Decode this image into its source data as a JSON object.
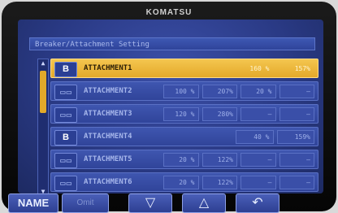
{
  "brand": "KOMATSU",
  "title": "Breaker/Attachment Setting",
  "rows": [
    {
      "badge": "B",
      "badge_style": "bright",
      "name": "ATTACHMENT1",
      "c1_pre": "",
      "c1": "",
      "c2_pre": "",
      "c2": "160 %",
      "c3_pre": "",
      "c3": "157%"
    },
    {
      "badge": "",
      "badge_style": "dim",
      "name": "ATTACHMENT2",
      "c1_pre": "",
      "c1": "100 %",
      "c2_pre": "",
      "c2": "207%",
      "c3_pre": "",
      "c3": "20 %",
      "c4": "—"
    },
    {
      "badge": "",
      "badge_style": "dim",
      "name": "ATTACHMENT3",
      "c1_pre": "",
      "c1": "120 %",
      "c2_pre": "",
      "c2": "280%",
      "c3_pre": "",
      "c3": "—",
      "c4": "—"
    },
    {
      "badge": "B",
      "badge_style": "bright",
      "name": "ATTACHMENT4",
      "c1_pre": "",
      "c1": "",
      "c2_pre": "",
      "c2": "40 %",
      "c3_pre": "",
      "c3": "159%"
    },
    {
      "badge": "",
      "badge_style": "dim",
      "name": "ATTACHMENT5",
      "c1_pre": "",
      "c1": "20 %",
      "c2_pre": "",
      "c2": "122%",
      "c3_pre": "",
      "c3": "—",
      "c4": "—"
    },
    {
      "badge": "",
      "badge_style": "dim",
      "name": "ATTACHMENT6",
      "c1_pre": "",
      "c1": "20 %",
      "c2_pre": "",
      "c2": "122%",
      "c3_pre": "",
      "c3": "—",
      "c4": "—"
    }
  ],
  "softkeys": {
    "k1": "NAME",
    "k2": "Omit",
    "k3_icon": "down-triangle-icon",
    "k4_icon": "up-triangle-icon",
    "k5_icon": "return-arrow-icon"
  },
  "colors": {
    "accent": "#e4a92a",
    "screen": "#2a3a85"
  }
}
